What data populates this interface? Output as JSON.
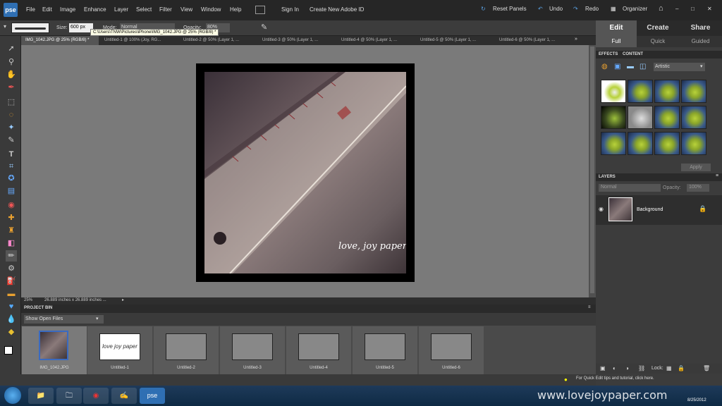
{
  "app": {
    "logo": "pse"
  },
  "menu": [
    "File",
    "Edit",
    "Image",
    "Enhance",
    "Layer",
    "Select",
    "Filter",
    "View",
    "Window",
    "Help"
  ],
  "menu_right": {
    "sign_in": "Sign In",
    "create_id": "Create New Adobe ID",
    "reset_panels": "Reset Panels",
    "undo": "Undo",
    "redo": "Redo",
    "organizer": "Organizer"
  },
  "options": {
    "size_label": "Size:",
    "size_value": "600 px",
    "mode_label": "Mode:",
    "mode_value": "Normal",
    "opacity_label": "Opacity:",
    "opacity_value": "80%",
    "tooltip": "C:\\Users\\TNW\\Pictures\\iPhone\\IMG_1042.JPG @ 25% (RGB/8) *"
  },
  "doc_tabs": [
    "IMG_1042.JPG @ 25% (RGB/8) *",
    "Untitled-1 @ 100% (Joy, RG...",
    "Untitled-2 @ 50% (Layer 1, ...",
    "Untitled-3 @ 50% (Layer 1, ...",
    "Untitled-4 @ 50% (Layer 1, ...",
    "Untitled-5 @ 50% (Layer 1, ...",
    "Untitled-6 @ 50% (Layer 1, ..."
  ],
  "status": {
    "zoom": "25%",
    "dimensions": "26.889 inches x 26.889 inches ..."
  },
  "project_bin": {
    "title": "PROJECT BIN",
    "dropdown": "Show Open Files",
    "items": [
      "IMG_1042.JPG",
      "Untitled-1",
      "Untitled-2",
      "Untitled-3",
      "Untitled-4",
      "Untitled-5",
      "Untitled-6"
    ]
  },
  "panel": {
    "tabs": [
      "Edit",
      "Create",
      "Share"
    ],
    "subtabs": [
      "Full",
      "Quick",
      "Guided"
    ],
    "effects_tabs": [
      "EFFECTS",
      "CONTENT"
    ],
    "effects_dropdown": "Artistic",
    "apply": "Apply",
    "layers_title": "LAYERS",
    "blend": "Normal",
    "opacity_label": "Opacity:",
    "opacity_value": "100%",
    "layer_name": "Background",
    "lock_label": "Lock:"
  },
  "footer": {
    "hint": "For Quick Edit tips and tutorial, click here.",
    "watermark": "www.lovejoypaper.com",
    "date": "8/25/2012"
  },
  "photo": {
    "text": "love, joy paper"
  },
  "taskbar_active": "pse"
}
